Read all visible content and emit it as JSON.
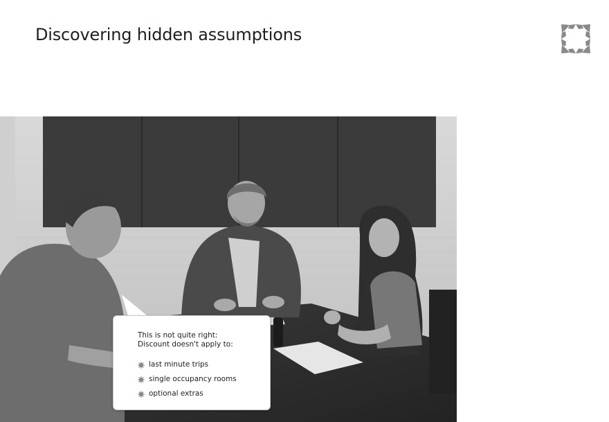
{
  "slide": {
    "title": "Discovering hidden assumptions",
    "logo_icon": "starburst-frame-icon"
  },
  "photo": {
    "description_icon": "meeting-photo"
  },
  "callout": {
    "line1": "This is not quite right:",
    "line2": "Discount doesn't apply to:",
    "items": [
      "last minute trips",
      "single occupancy rooms",
      "optional extras"
    ],
    "bullet_icon": "sparkle-bullet-icon"
  },
  "colors": {
    "text": "#1f1f1f",
    "logo_gray": "#8a8a8a",
    "background": "#ffffff"
  }
}
